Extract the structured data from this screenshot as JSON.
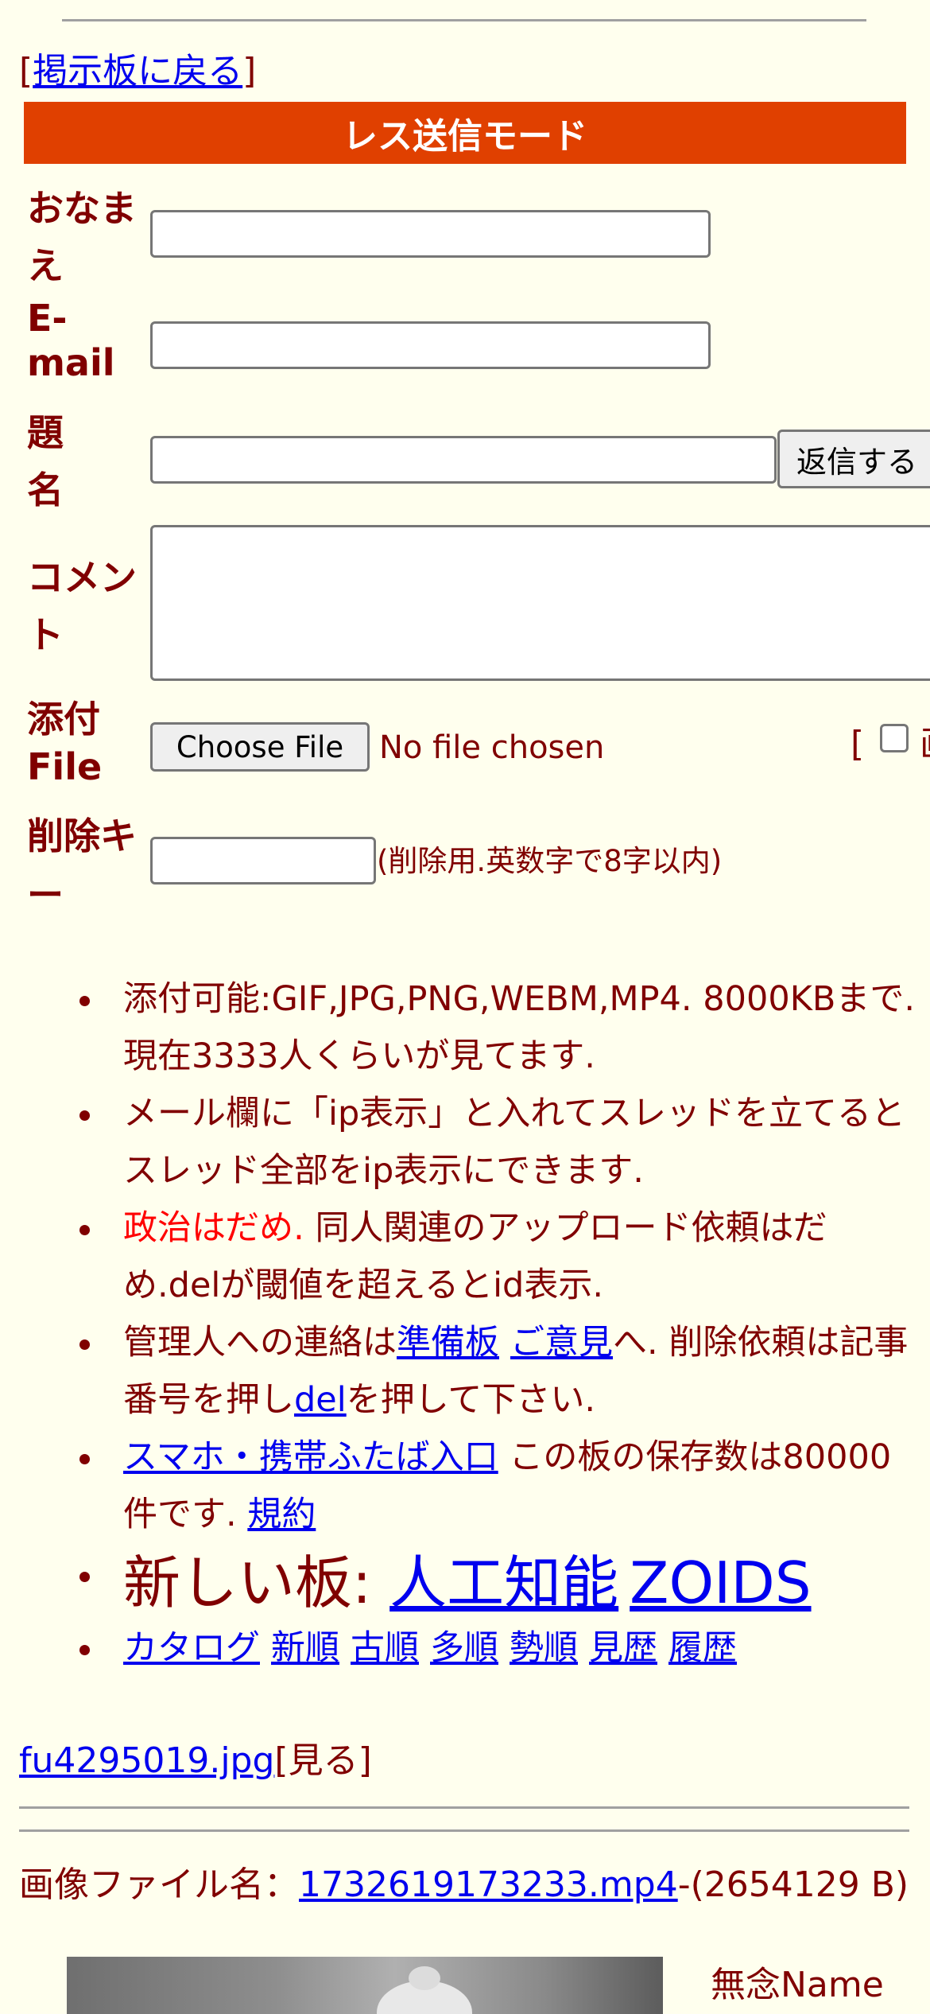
{
  "back_link": {
    "open": "[",
    "label": "掲示板に戻る",
    "close": "]"
  },
  "banner": "レス送信モード",
  "form": {
    "name_label": "おなまえ",
    "email_label": "E-mail",
    "subject_label": "題名",
    "submit_label": "返信する",
    "comment_label": "コメント",
    "attach_label": "添付File",
    "choose_file_label": "Choose File",
    "no_file_text": "No file chosen",
    "image_bracket": "[",
    "image_char": "画",
    "delkey_label": "削除キー",
    "delkey_note": "(削除用.英数字で8字以内)"
  },
  "rules": {
    "r1": "添付可能:GIF,JPG,PNG,WEBM,MP4. 8000KBまで. 現在3333人くらいが見てます.",
    "r2": "メール欄に「ip表示」と入れてスレッドを立てるとスレッド全部をip表示にできます.",
    "r3_red": "政治はだめ.",
    "r3_rest": " 同人関連のアップロード依頼はだめ.delが閾値を超えるとid表示.",
    "r4_a": "管理人への連絡は",
    "r4_link1": "準備板",
    "r4_link2": "ご意見",
    "r4_b": "へ. 削除依頼は記事番号を押し",
    "r4_link3": "del",
    "r4_c": "を押して下さい.",
    "r5_link": "スマホ・携帯ふたば入口",
    "r5_text": " この板の保存数は80000件です. ",
    "r5_link2": "規約",
    "r6_text": "新しい板: ",
    "r6_link1": "人工知能",
    "r6_link2": "ZOIDS",
    "r7_links": [
      "カタログ",
      "新順",
      "古順",
      "多順",
      "勢順",
      "見歴",
      "履歴"
    ]
  },
  "file_line": {
    "name": "fu4295019.jpg",
    "view": "[見る]"
  },
  "post": {
    "file_label": "画像ファイル名：",
    "file_name": "1732619173233.mp4",
    "file_size": "-(2654129 B)",
    "author": "無念Name"
  }
}
